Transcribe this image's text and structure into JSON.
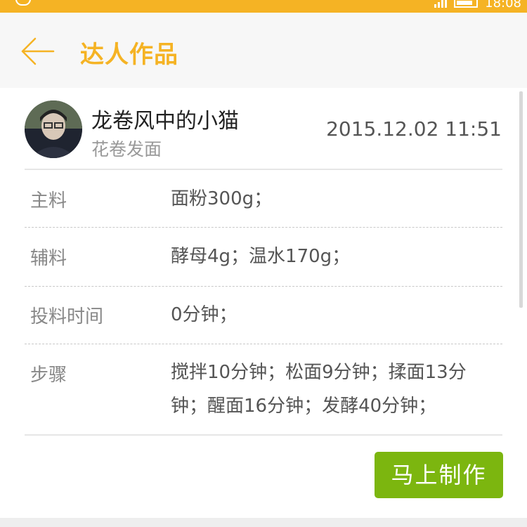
{
  "status_bar": {
    "background": "#f5b324",
    "time": "18:08"
  },
  "header": {
    "title": "达人作品",
    "accent_color": "#f5b324"
  },
  "post": {
    "user_name": "龙卷风中的小猫",
    "recipe_name": "花卷发面",
    "timestamp": "2015.12.02 11:51"
  },
  "details": [
    {
      "label": "主料",
      "value": "面粉300g；"
    },
    {
      "label": "辅料",
      "value": "酵母4g；温水170g；"
    },
    {
      "label": "投料时间",
      "value": "0分钟；"
    },
    {
      "label": "步骤",
      "value": "搅拌10分钟；松面9分钟；揉面13分钟；醒面16分钟；发酵40分钟；"
    }
  ],
  "actions": {
    "make_now_label": "马上制作",
    "button_color": "#7cb60f"
  },
  "icons": {
    "back": "arrow-left-icon",
    "avatar": "user-avatar"
  }
}
